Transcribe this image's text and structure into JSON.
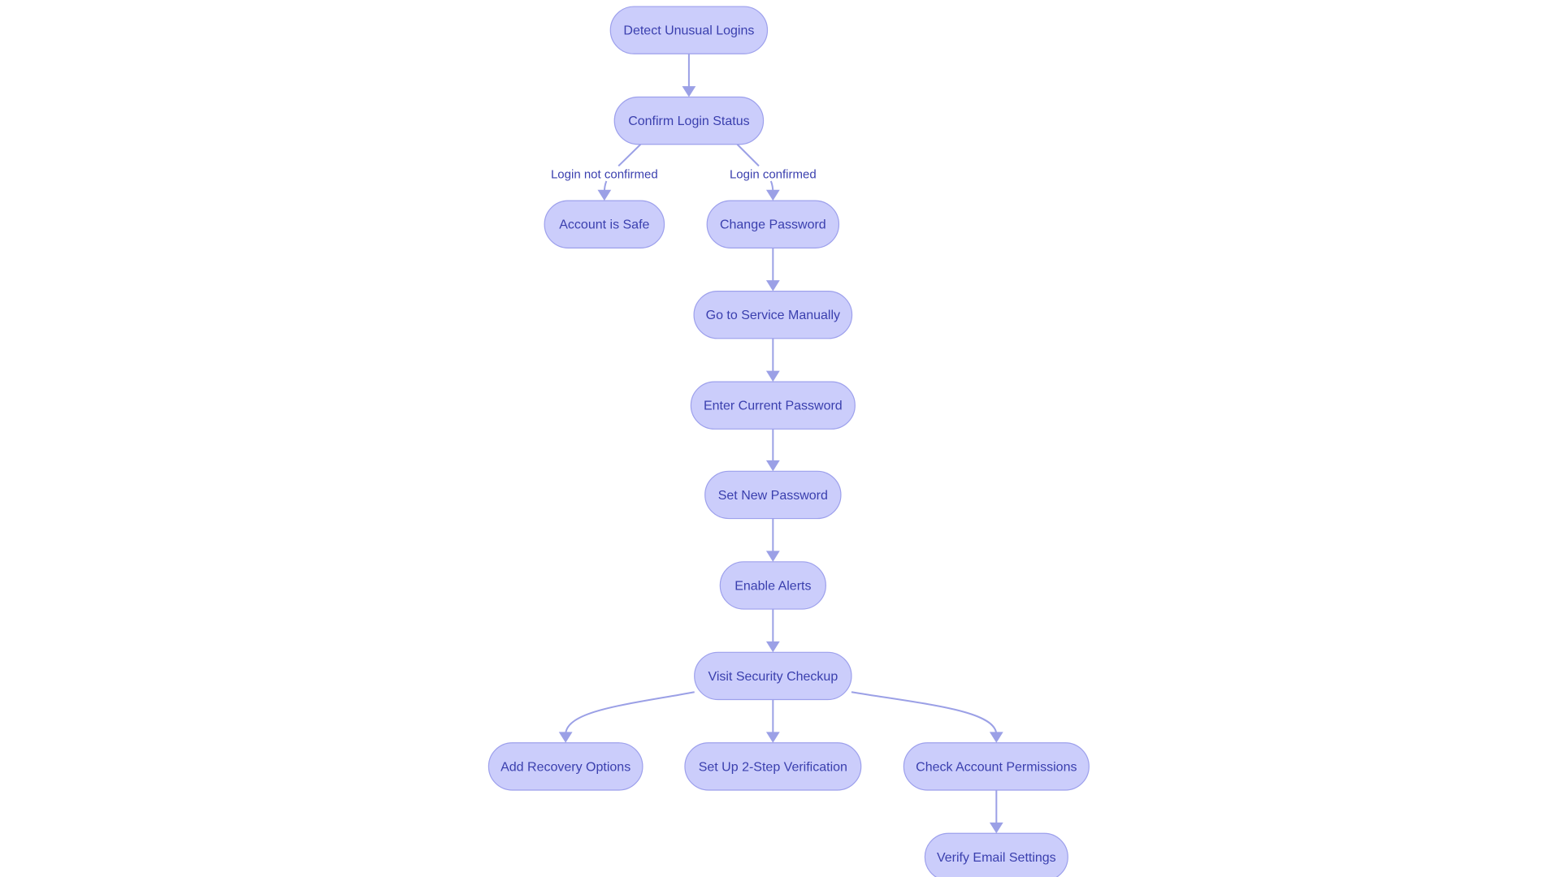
{
  "diagram": {
    "type": "flowchart",
    "direction": "top-down",
    "colors": {
      "node_fill": "#cbcdfb",
      "node_stroke": "#9da0ec",
      "text": "#3a3fae",
      "edge": "#9ba0e6",
      "background": "#ffffff"
    },
    "nodes": [
      {
        "id": "detect",
        "label": "Detect Unusual Logins"
      },
      {
        "id": "confirm",
        "label": "Confirm Login Status"
      },
      {
        "id": "safe",
        "label": "Account is Safe"
      },
      {
        "id": "change",
        "label": "Change Password"
      },
      {
        "id": "goto",
        "label": "Go to Service Manually"
      },
      {
        "id": "enter",
        "label": "Enter Current Password"
      },
      {
        "id": "setnew",
        "label": "Set New Password"
      },
      {
        "id": "alerts",
        "label": "Enable Alerts"
      },
      {
        "id": "checkup",
        "label": "Visit Security Checkup"
      },
      {
        "id": "recovery",
        "label": "Add Recovery Options"
      },
      {
        "id": "twostep",
        "label": "Set Up 2-Step Verification"
      },
      {
        "id": "perms",
        "label": "Check Account Permissions"
      },
      {
        "id": "email",
        "label": "Verify Email Settings"
      }
    ],
    "edges": [
      {
        "from": "detect",
        "to": "confirm",
        "label": ""
      },
      {
        "from": "confirm",
        "to": "safe",
        "label": "Login not confirmed"
      },
      {
        "from": "confirm",
        "to": "change",
        "label": "Login confirmed"
      },
      {
        "from": "change",
        "to": "goto",
        "label": ""
      },
      {
        "from": "goto",
        "to": "enter",
        "label": ""
      },
      {
        "from": "enter",
        "to": "setnew",
        "label": ""
      },
      {
        "from": "setnew",
        "to": "alerts",
        "label": ""
      },
      {
        "from": "alerts",
        "to": "checkup",
        "label": ""
      },
      {
        "from": "checkup",
        "to": "recovery",
        "label": ""
      },
      {
        "from": "checkup",
        "to": "twostep",
        "label": ""
      },
      {
        "from": "checkup",
        "to": "perms",
        "label": ""
      },
      {
        "from": "perms",
        "to": "email",
        "label": ""
      }
    ]
  }
}
